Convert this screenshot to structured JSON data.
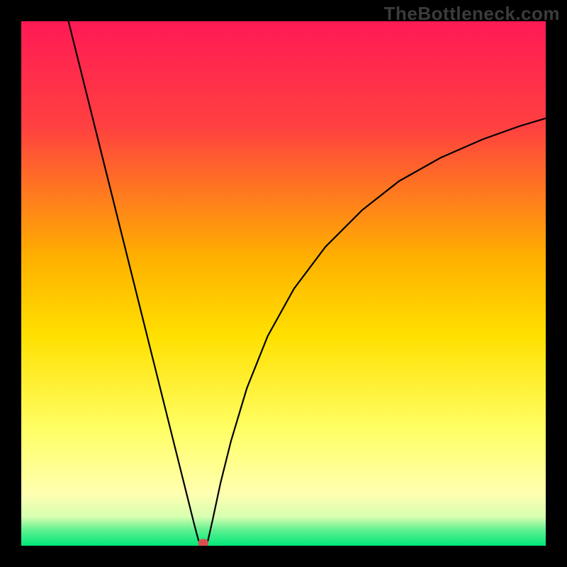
{
  "watermark": "TheBottleneck.com",
  "chart_data": {
    "type": "line",
    "title": "",
    "subtitle": "",
    "xlabel": "",
    "ylabel": "",
    "xlim": [
      0,
      100
    ],
    "ylim": [
      0,
      100
    ],
    "grid": false,
    "legend": "none",
    "background_gradient": {
      "stops": [
        {
          "offset": 0.0,
          "color": "#ff1a55"
        },
        {
          "offset": 0.2,
          "color": "#ff4040"
        },
        {
          "offset": 0.45,
          "color": "#ffb000"
        },
        {
          "offset": 0.6,
          "color": "#ffe000"
        },
        {
          "offset": 0.78,
          "color": "#ffff66"
        },
        {
          "offset": 0.9,
          "color": "#ffffb0"
        },
        {
          "offset": 0.945,
          "color": "#d7ffb0"
        },
        {
          "offset": 0.97,
          "color": "#60f090"
        },
        {
          "offset": 1.0,
          "color": "#00e879"
        }
      ]
    },
    "series": [
      {
        "name": "left-branch",
        "color": "#000000",
        "width": 2.2,
        "points": [
          {
            "x": 9.0,
            "y": 100.0
          },
          {
            "x": 10.5,
            "y": 94.0
          },
          {
            "x": 13.0,
            "y": 84.0
          },
          {
            "x": 16.0,
            "y": 72.0
          },
          {
            "x": 19.0,
            "y": 60.0
          },
          {
            "x": 22.0,
            "y": 48.0
          },
          {
            "x": 25.0,
            "y": 36.0
          },
          {
            "x": 27.0,
            "y": 28.0
          },
          {
            "x": 29.0,
            "y": 20.0
          },
          {
            "x": 30.0,
            "y": 16.0
          },
          {
            "x": 31.0,
            "y": 12.0
          },
          {
            "x": 32.0,
            "y": 8.0
          },
          {
            "x": 33.0,
            "y": 4.0
          },
          {
            "x": 33.8,
            "y": 1.0
          }
        ]
      },
      {
        "name": "right-branch",
        "color": "#000000",
        "width": 2.2,
        "points": [
          {
            "x": 35.6,
            "y": 1.0
          },
          {
            "x": 36.5,
            "y": 5.0
          },
          {
            "x": 38.0,
            "y": 12.0
          },
          {
            "x": 40.0,
            "y": 20.0
          },
          {
            "x": 43.0,
            "y": 30.0
          },
          {
            "x": 47.0,
            "y": 40.0
          },
          {
            "x": 52.0,
            "y": 49.0
          },
          {
            "x": 58.0,
            "y": 57.0
          },
          {
            "x": 65.0,
            "y": 64.0
          },
          {
            "x": 72.0,
            "y": 69.5
          },
          {
            "x": 80.0,
            "y": 74.0
          },
          {
            "x": 88.0,
            "y": 77.5
          },
          {
            "x": 95.0,
            "y": 80.0
          },
          {
            "x": 100.0,
            "y": 81.5
          }
        ]
      }
    ],
    "marker": {
      "cx": 34.7,
      "cy": 0.5,
      "rx": 1.0,
      "ry": 0.8,
      "fill": "#d94f4f",
      "stroke": "none"
    },
    "annotations": []
  }
}
